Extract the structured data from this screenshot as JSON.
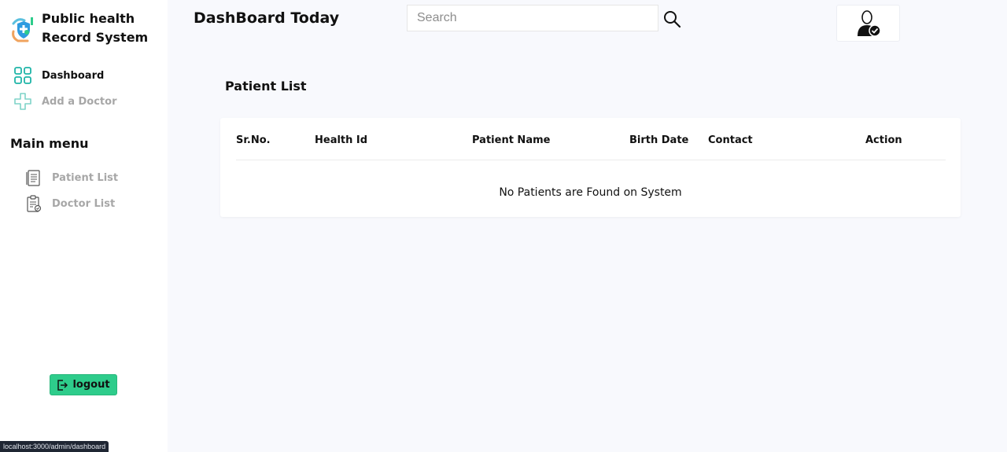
{
  "brand": {
    "title": "Public health Record System"
  },
  "sidebar": {
    "nav": [
      {
        "label": "Dashboard",
        "icon": "dashboard-grid-icon",
        "active": true
      },
      {
        "label": "Add a Doctor",
        "icon": "medical-cross-icon",
        "active": false
      }
    ],
    "main_menu_title": "Main menu",
    "sub_items": [
      {
        "label": "Patient List",
        "icon": "document-list-icon"
      },
      {
        "label": "Doctor List",
        "icon": "clipboard-icon"
      }
    ],
    "logout_label": "logout"
  },
  "header": {
    "title": "DashBoard Today",
    "search_placeholder": "Search"
  },
  "patients": {
    "title": "Patient List",
    "columns": [
      "Sr.No.",
      "Health Id",
      "Patient Name",
      "Birth Date",
      "Contact",
      "Action"
    ],
    "empty_message": "No Patients are Found on System"
  },
  "status_bar": {
    "url": "localhost:3000/admin/dashboard"
  },
  "colors": {
    "accent": "#2ecc8b",
    "icon_teal": "#1fb5a8",
    "background": "#f8f9fd",
    "muted_text": "#a7a7a7"
  }
}
